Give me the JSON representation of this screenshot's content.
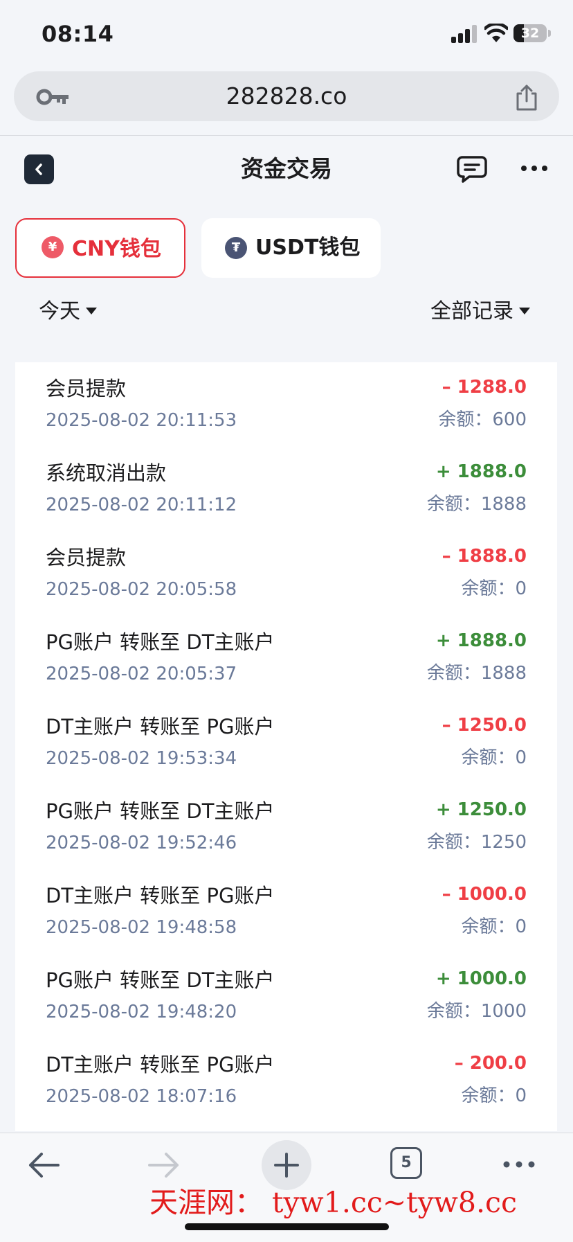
{
  "status_bar": {
    "time": "08:14",
    "battery": "32",
    "battery_level": 0.32
  },
  "browser": {
    "url": "282828.co"
  },
  "header": {
    "title": "资金交易"
  },
  "wallet_tabs": [
    {
      "label": "CNY钱包",
      "icon_symbol": "¥",
      "active": true,
      "accent_color": "#e5303b"
    },
    {
      "label": "USDT钱包",
      "icon_symbol": "₮",
      "active": false
    }
  ],
  "filters": {
    "date": "今天",
    "record_type": "全部记录"
  },
  "transactions": [
    {
      "title": "会员提款",
      "datetime": "2025-08-02 20:11:53",
      "amount": "– 1288.0",
      "balance": "余额：600",
      "direction": "out"
    },
    {
      "title": "系统取消出款",
      "datetime": "2025-08-02 20:11:12",
      "amount": "+ 1888.0",
      "balance": "余额：1888",
      "direction": "in"
    },
    {
      "title": "会员提款",
      "datetime": "2025-08-02 20:05:58",
      "amount": "– 1888.0",
      "balance": "余额：0",
      "direction": "out"
    },
    {
      "title": "PG账户  转账至  DT主账户",
      "datetime": "2025-08-02 20:05:37",
      "amount": "+ 1888.0",
      "balance": "余额：1888",
      "direction": "in"
    },
    {
      "title": "DT主账户  转账至  PG账户",
      "datetime": "2025-08-02 19:53:34",
      "amount": "– 1250.0",
      "balance": "余额：0",
      "direction": "out"
    },
    {
      "title": "PG账户  转账至  DT主账户",
      "datetime": "2025-08-02 19:52:46",
      "amount": "+ 1250.0",
      "balance": "余额：1250",
      "direction": "in"
    },
    {
      "title": "DT主账户  转账至  PG账户",
      "datetime": "2025-08-02 19:48:58",
      "amount": "– 1000.0",
      "balance": "余额：0",
      "direction": "out"
    },
    {
      "title": "PG账户  转账至  DT主账户",
      "datetime": "2025-08-02 19:48:20",
      "amount": "+ 1000.0",
      "balance": "余额：1000",
      "direction": "in"
    },
    {
      "title": "DT主账户  转账至  PG账户",
      "datetime": "2025-08-02 18:07:16",
      "amount": "– 200.0",
      "balance": "余额：0",
      "direction": "out"
    }
  ],
  "toolbar": {
    "tab_count": "5"
  },
  "watermark": {
    "text": "天涯网： tyw1.cc~tyw8.cc"
  },
  "colors": {
    "negative": "#ef3e45",
    "positive": "#3c8d3a",
    "secondary_text": "#6b7a99"
  }
}
